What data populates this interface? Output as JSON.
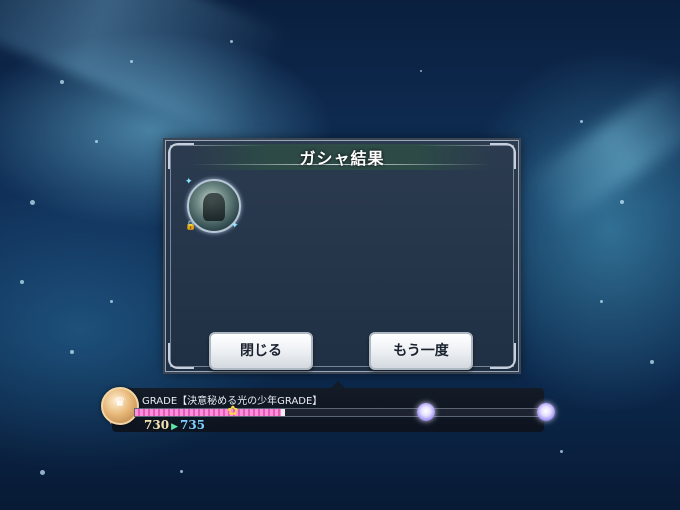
{
  "dialog": {
    "title": "ガシャ結果",
    "item": {
      "icon": "gacha-card-icon",
      "locked": true
    },
    "buttons": {
      "close_label": "閉じる",
      "again_label": "もう一度"
    }
  },
  "grade": {
    "label": "GRADE【決意秘める光の少年GRADE】",
    "points_before": "730",
    "points_after": "735",
    "progress_fraction": 0.355,
    "gain_fraction": 0.01,
    "reward_marker_fraction": 0.24,
    "colors": {
      "fill": "#ff8fd8",
      "points_before": "#f4e2b0",
      "points_after": "#7fd0ff",
      "arrow": "#5ee6a7"
    }
  }
}
